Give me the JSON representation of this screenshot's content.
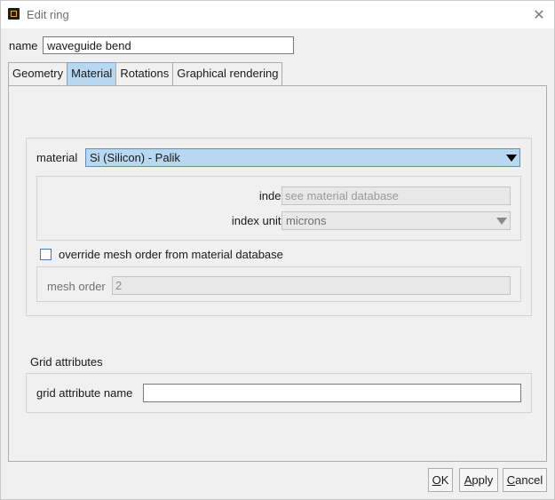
{
  "window": {
    "title": "Edit ring",
    "close_glyph": "✕",
    "app_icon": "ring-app-icon"
  },
  "name_row": {
    "label": "name",
    "value": "waveguide bend"
  },
  "tabs": [
    {
      "label": "Geometry",
      "active": false
    },
    {
      "label": "Material",
      "active": true
    },
    {
      "label": "Rotations",
      "active": false
    },
    {
      "label": "Graphical rendering",
      "active": false
    }
  ],
  "material_section": {
    "material_label": "material",
    "material_value": "Si (Silicon) - Palik",
    "index_label": "index",
    "index_placeholder": "see material database",
    "index_units_label": "index units",
    "index_units_value": "microns",
    "override_label": "override mesh order from material database",
    "override_checked": false,
    "mesh_order_label": "mesh order",
    "mesh_order_value": "2"
  },
  "grid_section": {
    "heading": "Grid attributes",
    "grid_attr_label": "grid attribute name",
    "grid_attr_value": ""
  },
  "buttons": {
    "ok_mnemonic": "O",
    "ok_rest": "K",
    "apply_mnemonic": "A",
    "apply_rest": "pply",
    "cancel_mnemonic": "C",
    "cancel_rest": "ancel"
  },
  "colors": {
    "selection_blue": "#b8d7f0",
    "checkbox_border": "#3d7dc8",
    "icon_accent": "#f0a818"
  }
}
